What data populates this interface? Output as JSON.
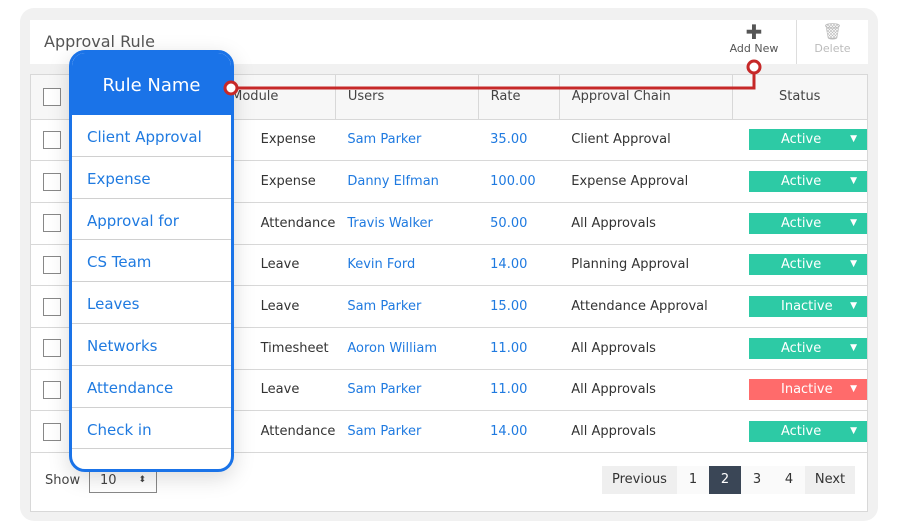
{
  "header": {
    "title": "Approval Rule",
    "add_new_label": "Add New",
    "delete_label": "Delete",
    "add_icon": "plus-icon",
    "delete_icon": "trash-icon"
  },
  "table": {
    "columns": [
      "",
      "Module",
      "Users",
      "Rate",
      "Approval Chain",
      "Status"
    ],
    "rows": [
      {
        "module": "Expense",
        "user": "Sam Parker",
        "rate": "35.00",
        "chain": "Client Approval",
        "status": "Active"
      },
      {
        "module": "Expense",
        "user": "Danny Elfman",
        "rate": "100.00",
        "chain": "Expense Approval",
        "status": "Active"
      },
      {
        "module": "Attendance",
        "user": "Travis Walker",
        "rate": "50.00",
        "chain": "All Approvals",
        "status": "Active"
      },
      {
        "module": "Leave",
        "user": "Kevin Ford",
        "rate": "14.00",
        "chain": "Planning Approval",
        "status": "Active"
      },
      {
        "module": "Leave",
        "user": "Sam Parker",
        "rate": "15.00",
        "chain": "Attendance Approval",
        "status": "Inactive"
      },
      {
        "module": "Timesheet",
        "user": "Aoron William",
        "rate": "11.00",
        "chain": "All Approvals",
        "status": "Active"
      },
      {
        "module": "Leave",
        "user": "Sam Parker",
        "rate": "11.00",
        "chain": "All Approvals",
        "status": "Inactive"
      },
      {
        "module": "Attendance",
        "user": "Sam Parker",
        "rate": "14.00",
        "chain": "All Approvals",
        "status": "Active"
      }
    ]
  },
  "footer": {
    "show_label": "Show",
    "page_size": "10",
    "pagination": {
      "previous": "Previous",
      "pages": [
        "1",
        "2",
        "3",
        "4"
      ],
      "current": "2",
      "next": "Next"
    }
  },
  "popup": {
    "title": "Rule Name",
    "items": [
      "Client Approval",
      "Expense",
      "Approval for",
      "CS Team",
      "Leaves",
      "Networks",
      "Attendance",
      "Check in"
    ]
  },
  "colors": {
    "accent": "#1a73e8",
    "active": "#2dcaa5",
    "inactive_alert": "#ff6b6b",
    "connector": "#c62828",
    "page_current": "#3a4656"
  }
}
